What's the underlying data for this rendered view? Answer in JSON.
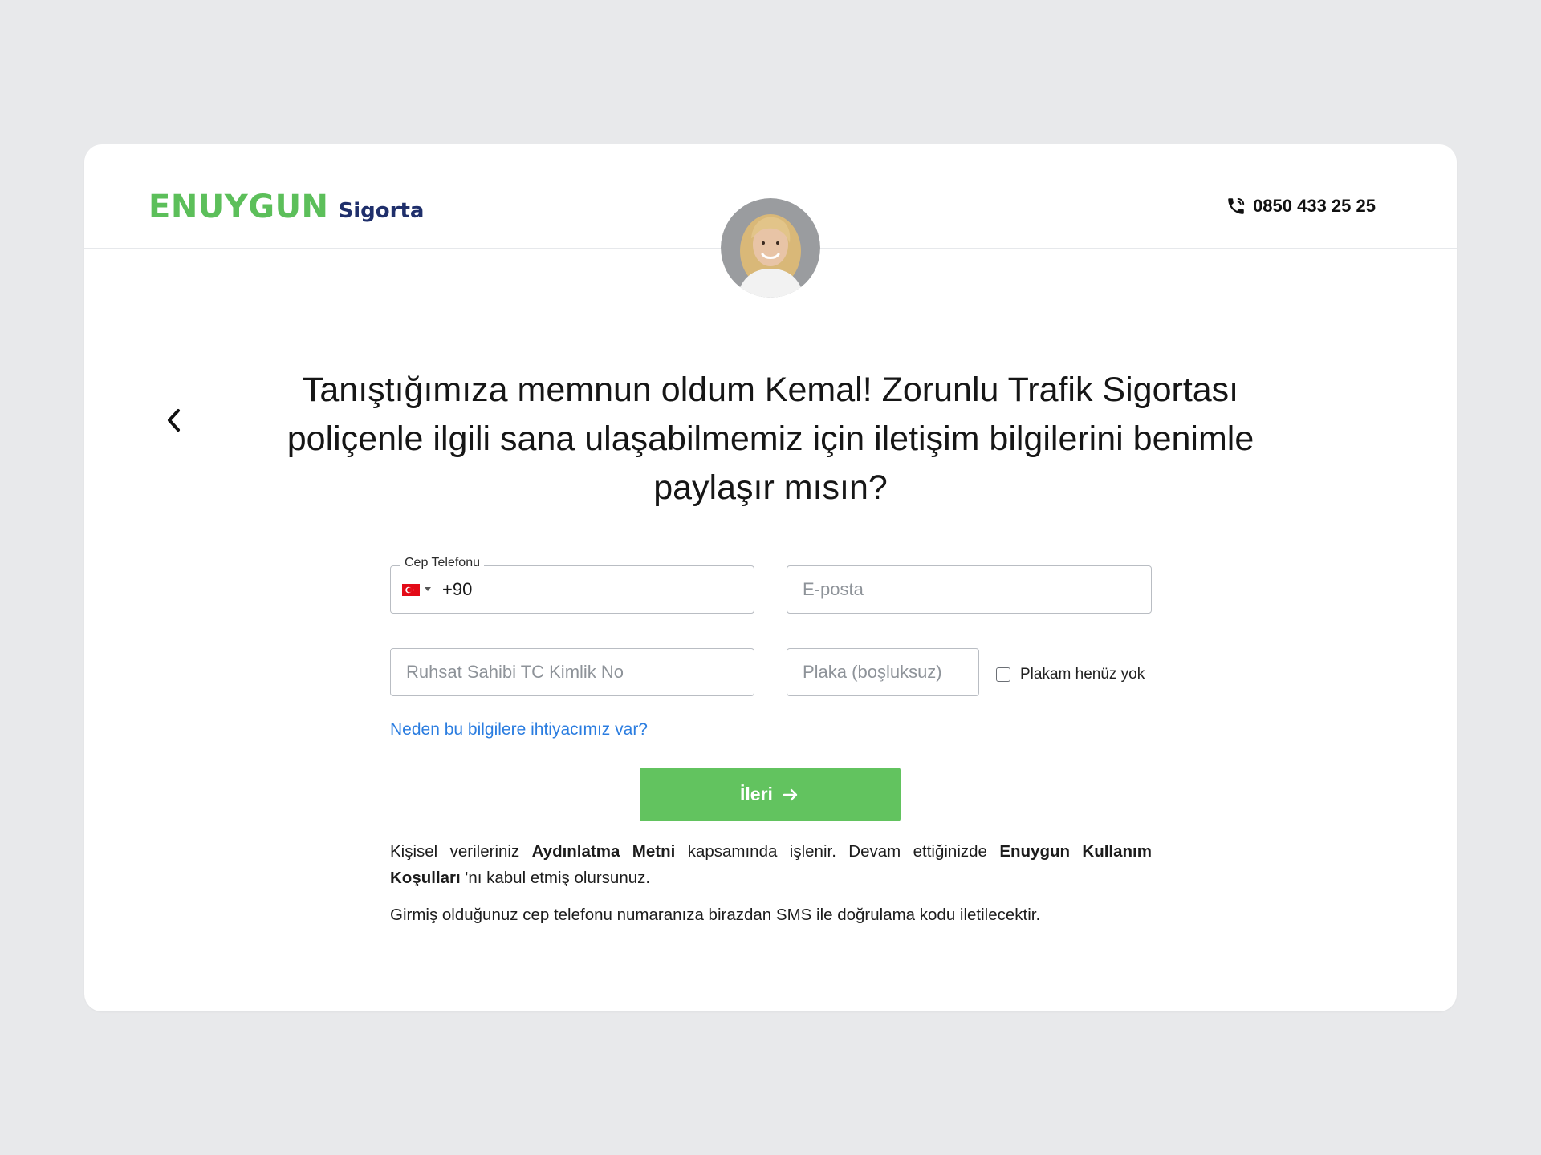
{
  "brand": {
    "name": "ENUYGUN",
    "sub": "Sigorta",
    "primary_color": "#5cbf5a",
    "secondary_color": "#1f2f6b"
  },
  "header": {
    "phone": "0850 433 25 25",
    "phone_icon": "phone-icon"
  },
  "agent": {
    "avatar": "agent-avatar"
  },
  "question": "Tanıştığımıza memnun oldum Kemal! Zorunlu Trafik Sigortası poliçenle ilgili sana ulaşabilmemiz için iletişim bilgilerini benimle paylaşır mısın?",
  "form": {
    "phone": {
      "label": "Cep Telefonu",
      "value": "+90",
      "country_flag": "turkey-flag"
    },
    "email": {
      "placeholder": "E-posta"
    },
    "tc_no": {
      "placeholder": "Ruhsat Sahibi TC Kimlik No"
    },
    "plate": {
      "placeholder": "Plaka (boşluksuz)"
    },
    "no_plate": {
      "label": "Plakam henüz yok",
      "checked": false
    },
    "why_link": "Neden bu bilgilere ihtiyacımız var?",
    "next_button": "İleri",
    "button_color": "#62c35f"
  },
  "legal": {
    "part1": "Kişisel verileriniz ",
    "link1": "Aydınlatma Metni",
    "part2": " kapsamında işlenir. Devam ettiğinizde ",
    "link2": "Enuygun Kullanım Koşulları",
    "part3": " 'nı kabul etmiş olursunuz.",
    "sms_note": "Girmiş olduğunuz cep telefonu numaranıza birazdan SMS ile doğrulama kodu iletilecektir."
  }
}
